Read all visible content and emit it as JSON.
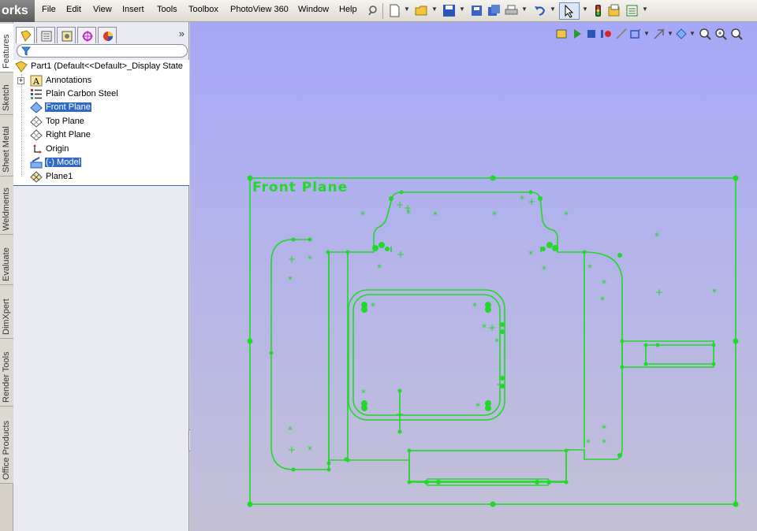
{
  "app": {
    "logo_text": "orks"
  },
  "menu": [
    "File",
    "Edit",
    "View",
    "Insert",
    "Tools",
    "Toolbox",
    "PhotoView 360",
    "Window",
    "Help"
  ],
  "toolbar_icons": [
    "pushpin-icon",
    "new-document-icon",
    "open-folder-icon",
    "save-icon",
    "print-icon",
    "undo-icon",
    "select-pointer-icon",
    "rebuild-icon",
    "file-properties-icon",
    "options-icon"
  ],
  "side_tabs": [
    "Features",
    "Sketch",
    "Sheet Metal",
    "Weldments",
    "Evaluate",
    "DimXpert",
    "Render Tools",
    "Office Products"
  ],
  "panel_tabs": [
    "featuremanager-tree-icon",
    "propertymanager-icon",
    "configurationmanager-icon",
    "dimxpertmanager-icon",
    "displaymanager-icon"
  ],
  "tree": {
    "root": "Part1  (Default<<Default>_Display State",
    "items": [
      {
        "label": "Annotations",
        "icon": "annotations-icon",
        "selected": false,
        "expandable": true
      },
      {
        "label": "Plain Carbon Steel",
        "icon": "material-icon",
        "selected": false,
        "expandable": false
      },
      {
        "label": "Front Plane",
        "icon": "plane-icon",
        "selected": true,
        "expandable": false
      },
      {
        "label": "Top Plane",
        "icon": "plane-icon",
        "selected": false,
        "expandable": false
      },
      {
        "label": "Right Plane",
        "icon": "plane-icon",
        "selected": false,
        "expandable": false
      },
      {
        "label": "Origin",
        "icon": "origin-icon",
        "selected": false,
        "expandable": false
      },
      {
        "label": "(-) Model",
        "icon": "sketch-icon",
        "selected": true,
        "expandable": false
      },
      {
        "label": "Plane1",
        "icon": "plane-icon",
        "selected": false,
        "expandable": false
      }
    ]
  },
  "viewport": {
    "plane_label": "Front Plane",
    "sketch_color": "#22d82a",
    "heads_up_icons": [
      "record-icon",
      "play-icon",
      "stop-icon",
      "record-pause-icon",
      "sketch-icon",
      "display-style-icon",
      "hide-show-icon",
      "view-orientation-icon",
      "zoom-to-fit-icon",
      "zoom-area-icon",
      "rotate-icon"
    ]
  },
  "colors": {
    "selection": "#316ac5",
    "sketch": "#22d82a",
    "viewport_top": "#a6a8f7",
    "viewport_bottom": "#c3c0d6"
  }
}
